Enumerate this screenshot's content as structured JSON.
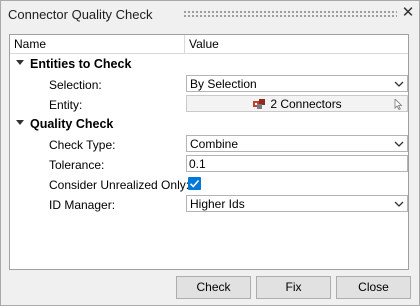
{
  "window": {
    "title": "Connector Quality Check"
  },
  "table": {
    "columns": {
      "name": "Name",
      "value": "Value"
    },
    "sections": {
      "entities": {
        "label": "Entities to Check",
        "selection": {
          "label": "Selection:",
          "value": "By Selection"
        },
        "entity": {
          "label": "Entity:",
          "value": "2 Connectors"
        }
      },
      "quality": {
        "label": "Quality Check",
        "check_type": {
          "label": "Check Type:",
          "value": "Combine"
        },
        "tolerance": {
          "label": "Tolerance:",
          "value": "0.1"
        },
        "consider_unrealized": {
          "label": "Consider Unrealized Only:",
          "checked": true
        },
        "id_manager": {
          "label": "ID Manager:",
          "value": "Higher Ids"
        }
      }
    }
  },
  "buttons": {
    "check": "Check",
    "fix": "Fix",
    "close": "Close"
  },
  "colors": {
    "accent": "#0078d7",
    "border": "#a0a0a0",
    "button_bg": "#e1e1e1"
  },
  "icons": {
    "close": "close-icon",
    "entity": "connector-icon",
    "cursor": "mouse-cursor-icon"
  }
}
